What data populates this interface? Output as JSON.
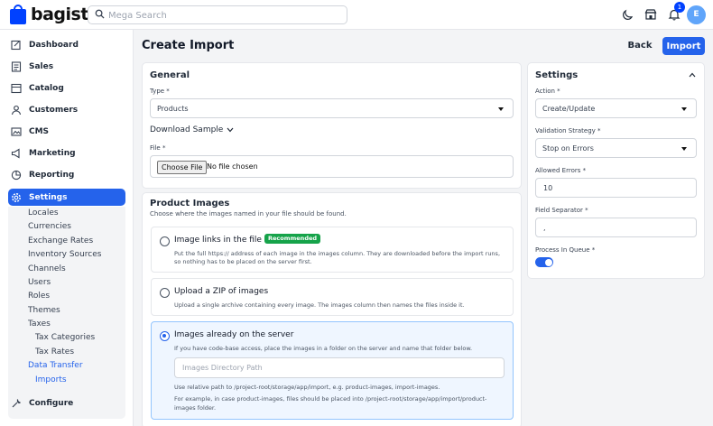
{
  "header": {
    "brand": "bagisto",
    "search_placeholder": "Mega Search",
    "notification_count": "1",
    "avatar_initial": "E"
  },
  "sidebar": {
    "items": [
      {
        "label": "Dashboard",
        "icon": "dashboard-icon"
      },
      {
        "label": "Sales",
        "icon": "sales-icon"
      },
      {
        "label": "Catalog",
        "icon": "catalog-icon"
      },
      {
        "label": "Customers",
        "icon": "customers-icon"
      },
      {
        "label": "CMS",
        "icon": "cms-icon"
      },
      {
        "label": "Marketing",
        "icon": "marketing-icon"
      },
      {
        "label": "Reporting",
        "icon": "reporting-icon"
      },
      {
        "label": "Settings",
        "icon": "settings-icon"
      },
      {
        "label": "Configure",
        "icon": "configure-icon"
      }
    ],
    "settings_children": [
      "Locales",
      "Currencies",
      "Exchange Rates",
      "Inventory Sources",
      "Channels",
      "Users",
      "Roles",
      "Themes",
      "Taxes",
      "Tax Categories",
      "Tax Rates",
      "Data Transfer",
      "Imports"
    ]
  },
  "page": {
    "title": "Create Import",
    "back_label": "Back",
    "import_label": "Import"
  },
  "general": {
    "title": "General",
    "type_label": "Type *",
    "type_value": "Products",
    "download_sample": "Download Sample",
    "file_label": "File *",
    "choose_file": "Choose File",
    "no_file": "No file chosen"
  },
  "images": {
    "title": "Product Images",
    "subtitle": "Choose where the images named in your file should be found.",
    "options": [
      {
        "title": "Image links in the file",
        "badge": "Recommended",
        "desc1": "Put the full https:// address of each image in the images column. They are downloaded before the import runs,",
        "desc2": "so nothing has to be placed on the server first."
      },
      {
        "title": "Upload a ZIP of images",
        "desc1": "Upload a single archive containing every image. The images column then names the files inside it."
      },
      {
        "title": "Images already on the server",
        "desc1": "If you have code-base access, place the images in a folder on the server and name that folder below.",
        "dir_placeholder": "Images Directory Path",
        "note1": "Use relative path to /project-root/storage/app/import, e.g. product-images, import-images.",
        "note2": "For example, in case product-images, files should be placed into /project-root/storage/app/import/product-",
        "note3": "images folder."
      }
    ]
  },
  "settings": {
    "title": "Settings",
    "action_label": "Action *",
    "action_value": "Create/Update",
    "validation_label": "Validation Strategy *",
    "validation_value": "Stop on Errors",
    "allowed_errors_label": "Allowed Errors *",
    "allowed_errors_value": "10",
    "field_sep_label": "Field Separator *",
    "field_sep_value": ",",
    "queue_label": "Process In Queue *",
    "queue_on": true
  },
  "colors": {
    "accent": "#2563eb",
    "brand": "#0041ff",
    "recommended": "#16a34a"
  }
}
